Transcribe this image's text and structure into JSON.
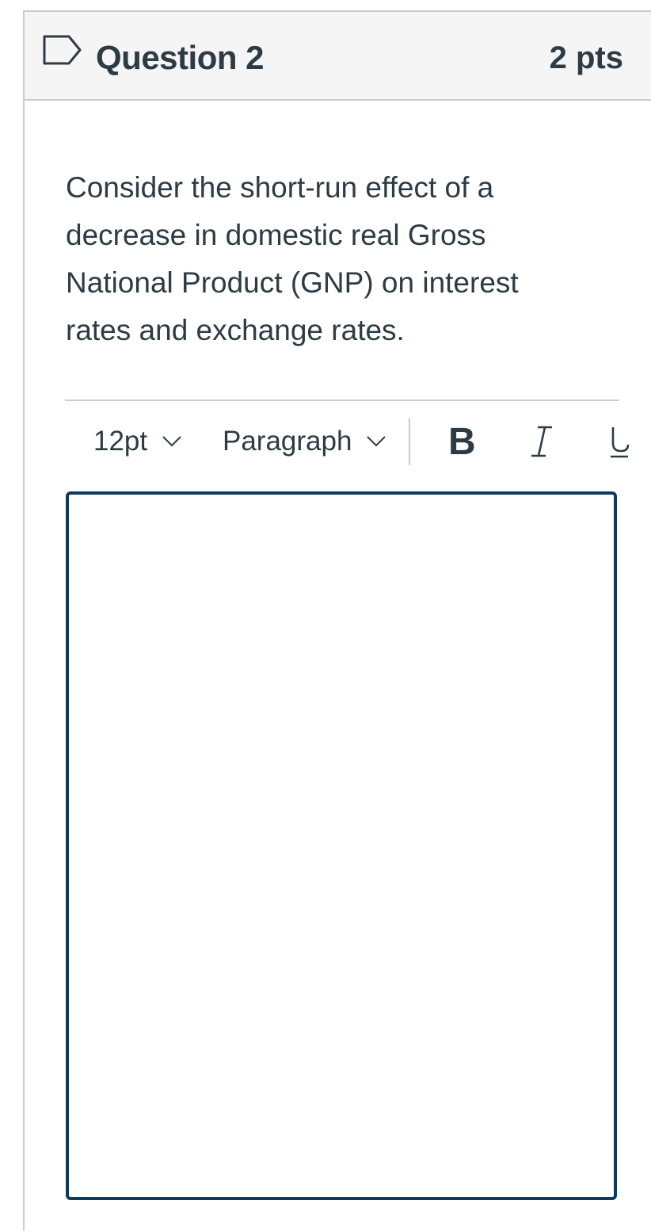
{
  "question": {
    "title": "Question 2",
    "points": "2 pts",
    "flag_icon": "flag-outline-icon",
    "text": "Consider the short-run effect of a decrease in domestic real Gross National Product (GNP) on interest rates and exchange rates."
  },
  "toolbar": {
    "font_size": "12pt",
    "block_format": "Paragraph",
    "bold_label": "B",
    "italic_icon": "italic-icon",
    "underline_icon": "underline-icon",
    "caret_icon": "chevron-down-icon"
  },
  "editor": {
    "value": ""
  },
  "colors": {
    "text": "#2d3b45",
    "header_bg": "#f5f5f5",
    "border": "#c7cdd1",
    "editor_focus_border": "#0e3a5e"
  }
}
